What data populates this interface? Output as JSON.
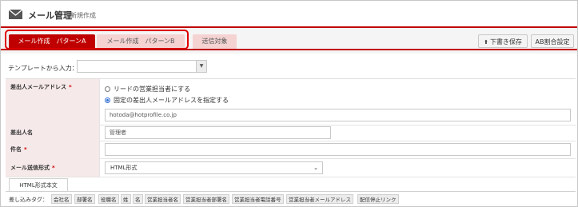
{
  "header": {
    "title": "メール管理",
    "subtitle": "新規作成",
    "icon": "mail-icon"
  },
  "tabs": [
    {
      "label": "メール作成　パターンA",
      "active": true
    },
    {
      "label": "メール作成　パターンB",
      "active": false
    },
    {
      "label": "送信対象",
      "active": false
    }
  ],
  "toolbar": {
    "draft_label": "下書き保存",
    "ab_label": "AB割合設定"
  },
  "template": {
    "label": "テンプレートから入力：",
    "value": ""
  },
  "form": {
    "sender_address": {
      "label": "差出人メールアドレス",
      "required_mark": "*",
      "options": [
        {
          "label": "リードの営業担当者にする",
          "checked": false
        },
        {
          "label": "固定の差出人メールアドレスを指定する",
          "checked": true
        }
      ],
      "value": "hotoda@hotprofile.co.jp"
    },
    "sender_name": {
      "label": "差出人名",
      "value": "管理者"
    },
    "subject": {
      "label": "件名",
      "required_mark": "*",
      "value": ""
    },
    "format": {
      "label": "メール送信形式",
      "required_mark": "*",
      "value": "HTML形式"
    }
  },
  "body_tab": {
    "label": "HTML形式本文"
  },
  "insert_tags": {
    "label": "差し込みタグ：",
    "items": [
      "会社名",
      "部署名",
      "役職名",
      "姓",
      "名",
      "営業担当者名",
      "営業担当者部署名",
      "営業担当者電話番号",
      "営業担当者メールアドレス",
      "配信停止リンク"
    ]
  },
  "colors": {
    "accent": "#c00000",
    "tab_inactive": "#f5d3d3",
    "label_bg": "#f6e9e9",
    "radio_checked": "#2a6bd1"
  }
}
